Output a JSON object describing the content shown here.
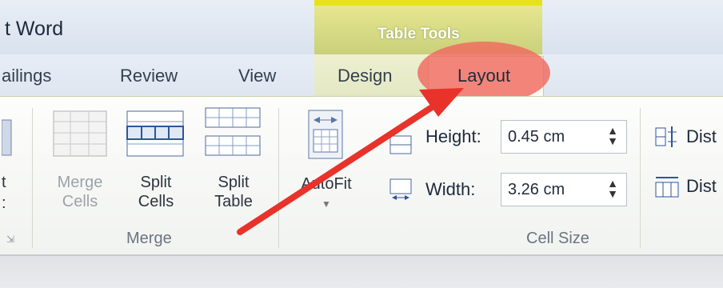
{
  "window": {
    "title": "t Word"
  },
  "contextual": {
    "label": "Table Tools"
  },
  "tabs": {
    "mailings": "ailings",
    "review": "Review",
    "view": "View",
    "design": "Design",
    "layout": "Layout"
  },
  "ribbon": {
    "left_fragment_top": "t",
    "left_fragment_bottom": ":",
    "merge_cells": {
      "line1": "Merge",
      "line2": "Cells"
    },
    "split_cells": {
      "line1": "Split",
      "line2": "Cells"
    },
    "split_table": {
      "line1": "Split",
      "line2": "Table"
    },
    "merge_group": "Merge",
    "autofit": "AutoFit",
    "height_label": "Height:",
    "height_value": "0.45 cm",
    "width_label": "Width:",
    "width_value": "3.26 cm",
    "cell_size_group": "Cell Size",
    "dist_1": "Dist",
    "dist_2": "Dist"
  },
  "colors": {
    "highlight": "#f0695f",
    "arrow": "#e8322a",
    "contextual_tab": "#e8e21a"
  },
  "icons": [
    "merge-cells-icon",
    "split-cells-icon",
    "split-table-icon",
    "autofit-icon",
    "row-height-icon",
    "column-width-icon",
    "distribute-rows-icon",
    "distribute-columns-icon",
    "spinner-icon",
    "dialog-launcher-icon",
    "annotation-arrow-icon"
  ]
}
